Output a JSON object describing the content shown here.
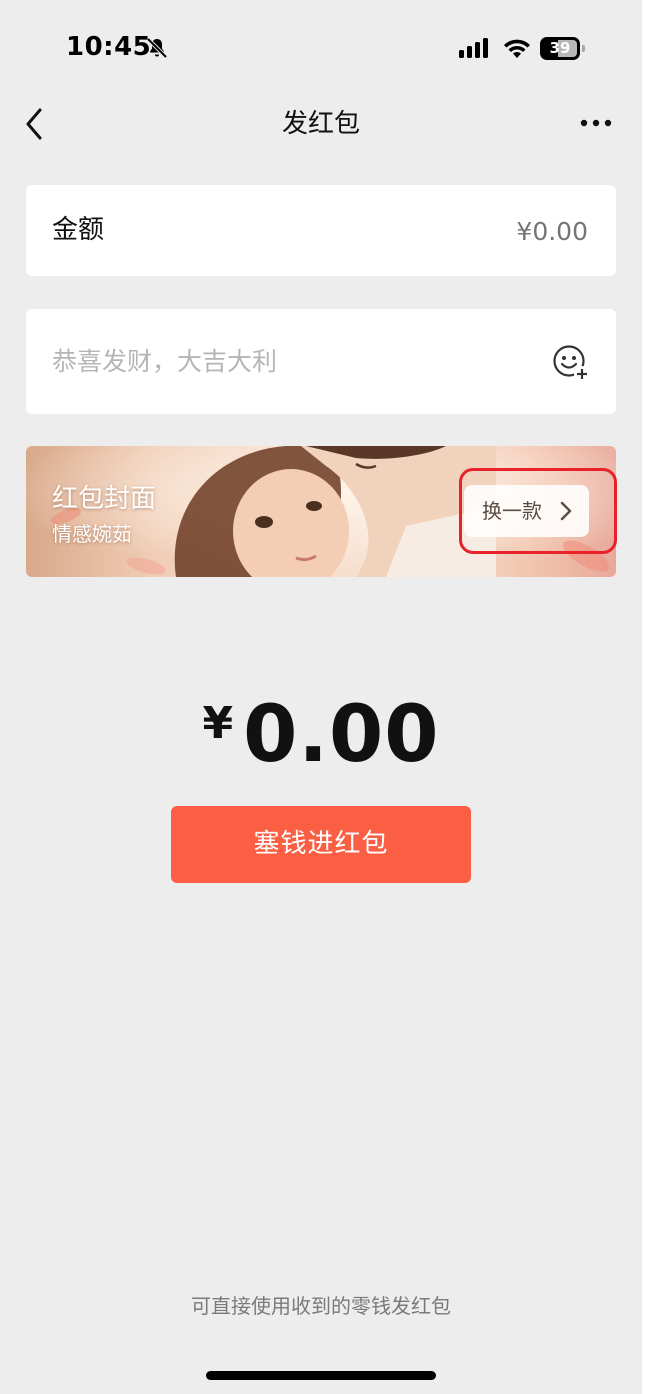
{
  "status_bar": {
    "time": "10:45",
    "battery": "39",
    "icons": [
      "bell-off-icon",
      "signal-icon",
      "wifi-icon",
      "battery-icon"
    ]
  },
  "nav": {
    "title": "发红包",
    "back_icon": "chevron-left-icon",
    "more_icon": "more-dots-icon"
  },
  "amount": {
    "label": "金额",
    "placeholder": "¥0.00"
  },
  "greeting": {
    "placeholder": "恭喜发财，大吉大利",
    "emoji_icon": "emoji-add-icon"
  },
  "cover": {
    "title": "红包封面",
    "subtitle": "情感婉茹",
    "change_label": "换一款",
    "change_icon": "chevron-right-icon"
  },
  "total": {
    "symbol": "¥",
    "value": "0.00"
  },
  "submit_label": "塞钱进红包",
  "footer_note": "可直接使用收到的零钱发红包",
  "colors": {
    "background": "#ededed",
    "primary_button": "#fa5e43",
    "highlight": "#e8222b"
  }
}
